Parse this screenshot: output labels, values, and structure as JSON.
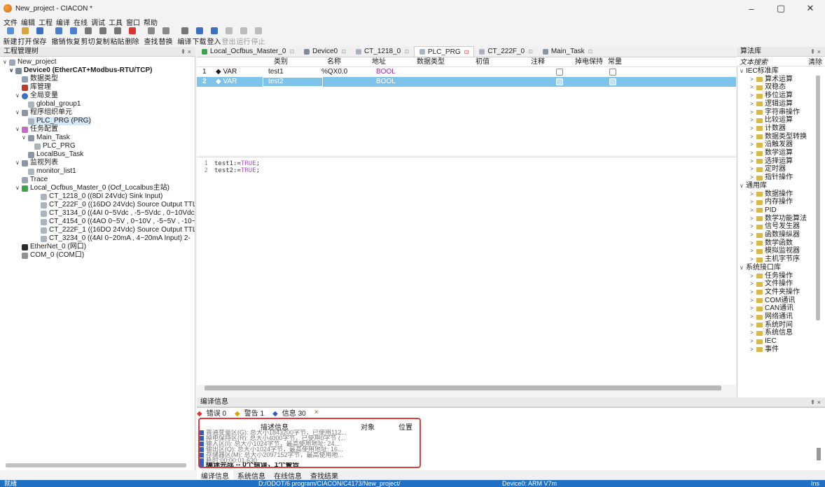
{
  "window": {
    "title": "New_project - CIACON *",
    "controls": [
      "–",
      "▢",
      "✕"
    ]
  },
  "menu": [
    "文件",
    "编辑",
    "工程",
    "编译",
    "在线",
    "调试",
    "工具",
    "窗口",
    "帮助"
  ],
  "toolbar": {
    "buttons": [
      {
        "label": "新建",
        "color": "#5a8fd6"
      },
      {
        "label": "打开",
        "color": "#d9a53a"
      },
      {
        "label": "保存",
        "color": "#3b6fc4"
      },
      {
        "label": "撤销",
        "color": "#4a7fd0"
      },
      {
        "label": "恢复",
        "color": "#4a7fd0"
      },
      {
        "label": "剪切",
        "color": "#555555"
      },
      {
        "label": "复制",
        "color": "#555555"
      },
      {
        "label": "粘贴",
        "color": "#555555"
      },
      {
        "label": "删除",
        "color": "#d93535"
      },
      {
        "label": "查找",
        "color": "#555555"
      },
      {
        "label": "替换",
        "color": "#555555"
      },
      {
        "label": "编译",
        "color": "#555555"
      },
      {
        "label": "下载",
        "color": "#3b6fc4"
      },
      {
        "label": "登入",
        "color": "#3b6fc4"
      },
      {
        "label": "登出",
        "color": "#aaaaaa"
      },
      {
        "label": "运行",
        "color": "#aaaaaa"
      },
      {
        "label": "停止",
        "color": "#aaaaaa"
      }
    ]
  },
  "project_tree": {
    "header": "工程管理树",
    "pin": "⇞ ×",
    "nodes": [
      {
        "label": "New_project",
        "toggle": "∨",
        "bold": false
      },
      {
        "label": "Device0 (EtherCAT+Modbus-RTU/TCP)",
        "toggle": "∨",
        "bold": true
      },
      {
        "label": "数据类型",
        "toggle": "",
        "bold": false
      },
      {
        "label": "库管理",
        "toggle": "",
        "bold": false
      },
      {
        "label": "全局变量",
        "toggle": "∨",
        "bold": false
      },
      {
        "label": "global_group1",
        "toggle": "",
        "bold": false
      },
      {
        "label": "程序组织单元",
        "toggle": "∨",
        "bold": false
      },
      {
        "label": "PLC_PRG (PRG)",
        "toggle": "",
        "bold": false
      },
      {
        "label": "任务配置",
        "toggle": "∨",
        "bold": false
      },
      {
        "label": "Main_Task",
        "toggle": "∨",
        "bold": false
      },
      {
        "label": "PLC_PRG",
        "toggle": "",
        "bold": false
      },
      {
        "label": "LocalBus_Task",
        "toggle": "",
        "bold": false
      },
      {
        "label": "监视列表",
        "toggle": "∨",
        "bold": false
      },
      {
        "label": "monitor_list1",
        "toggle": "",
        "bold": false
      },
      {
        "label": "Trace",
        "toggle": "",
        "bold": false
      },
      {
        "label": "Local_Ocfbus_Master_0 (Ocf_Localbus主站)",
        "toggle": "∨",
        "bold": false
      },
      {
        "label": "CT_1218_0 ((8DI 24Vdc) Sink Input)",
        "toggle": "",
        "bold": false
      },
      {
        "label": "CT_222F_0 ((16DO 24Vdc) Source Output TTL",
        "toggle": "",
        "bold": false
      },
      {
        "label": "CT_3134_0 ((4AI 0~5Vdc , -5~5Vdc , 0~10Vdc",
        "toggle": "",
        "bold": false
      },
      {
        "label": "CT_4154_0 ((4AO 0~5V , 0~10V , -5~5V , -10~",
        "toggle": "",
        "bold": false
      },
      {
        "label": "CT_222F_1 ((16DO 24Vdc) Source Output TTL",
        "toggle": "",
        "bold": false
      },
      {
        "label": "CT_3234_0 ((4AI 0~20mA , 4~20mA Input) 2-",
        "toggle": "",
        "bold": false
      },
      {
        "label": "EtherNet_0 (网口)",
        "toggle": "",
        "bold": false
      },
      {
        "label": "COM_0 (COM口)",
        "toggle": "",
        "bold": false
      }
    ]
  },
  "tabs": [
    {
      "label": "Local_Ocfbus_Master_0",
      "close": "⊡",
      "active": false
    },
    {
      "label": "Device0",
      "close": "⊡",
      "active": false
    },
    {
      "label": "CT_1218_0",
      "close": "⊡",
      "active": false
    },
    {
      "label": "PLC_PRG",
      "close": "⊡",
      "active": true
    },
    {
      "label": "CT_222F_0",
      "close": "⊡",
      "active": false
    },
    {
      "label": "Main_Task",
      "close": "⊡",
      "active": false
    }
  ],
  "var_table": {
    "headers": {
      "kind": "类别",
      "name": "名称",
      "address": "地址",
      "type": "数据类型",
      "init": "初值",
      "comment": "注释",
      "retain": "掉电保持",
      "constant": "常量"
    },
    "rows": [
      {
        "num": "1",
        "kind": "VAR",
        "name": "test1",
        "address": "%QX0.0",
        "type": "BOOL",
        "retain": false,
        "constant": false
      },
      {
        "num": "2",
        "kind": "VAR",
        "name": "test2",
        "address": "",
        "type": "BOOL",
        "retain": false,
        "constant": false
      }
    ]
  },
  "code": {
    "lines": [
      {
        "num": "1",
        "pre": "test1:=",
        "kw": "TRUE",
        "post": ";"
      },
      {
        "num": "2",
        "pre": "test2:=",
        "kw": "TRUE",
        "post": ";"
      }
    ]
  },
  "compile": {
    "header": "编译信息",
    "filters": {
      "errors": "错误 0",
      "warnings": "警告 1",
      "infos": "信息 30",
      "clear": "×"
    },
    "columns": {
      "desc": "描述信息",
      "object": "对象",
      "position": "位置"
    },
    "messages": [
      "普通变量区(G): 总大小1843200字节，已使用112...",
      "掉电保持区(R): 总大小4000字节，已使用0字节 (...",
      "输入区(I): 总大小1024字节，最高使用地址: 24...",
      "输出区(Q): 总大小1024字节，最高使用地址: 16...",
      "存储器区(M): 总大小2097152字节，最高使用地...",
      "耗时:00:00:01.630"
    ],
    "summary": "编译完成 -- 0个错误，1个警告"
  },
  "bottom_tabs": [
    "编译信息",
    "系统信息",
    "在线信息",
    "查找结果"
  ],
  "library": {
    "header": "算法库",
    "pin": "⇞ ×",
    "search_placeholder": "文本搜索",
    "clear": "清除",
    "groups": [
      {
        "label": "IEC标准库",
        "items": [
          "算术运算",
          "双稳态",
          "移位运算",
          "逻辑运算",
          "字符串操作",
          "比较运算",
          "计数器",
          "数据类型转换",
          "沿触发器",
          "数学运算",
          "选择运算",
          "定时器",
          "指针操作"
        ]
      },
      {
        "label": "通用库",
        "items": [
          "数据操作",
          "内存操作",
          "PID",
          "数学功能算法",
          "信号发生器",
          "函数操纵器",
          "数学函数",
          "模拟监视器",
          "主机字节序"
        ]
      },
      {
        "label": "系统接口库",
        "items": [
          "任务操作",
          "文件操作",
          "文件夹操作",
          "COM通讯",
          "CAN通讯",
          "网络通讯",
          "系统时间",
          "系统信息",
          "IEC",
          "事件"
        ]
      }
    ]
  },
  "status": {
    "left": "就绪",
    "path": "D:/ODOT/6 program/CIACON/C4173/New_project/",
    "device": "Device0: ARM V7m",
    "mode": "Ins"
  },
  "colors": {
    "selection": "#7ec3ea",
    "status_bar": "#1f6fc5",
    "highlight_box": "#e23b3b",
    "keyword": "#b04bd1"
  }
}
